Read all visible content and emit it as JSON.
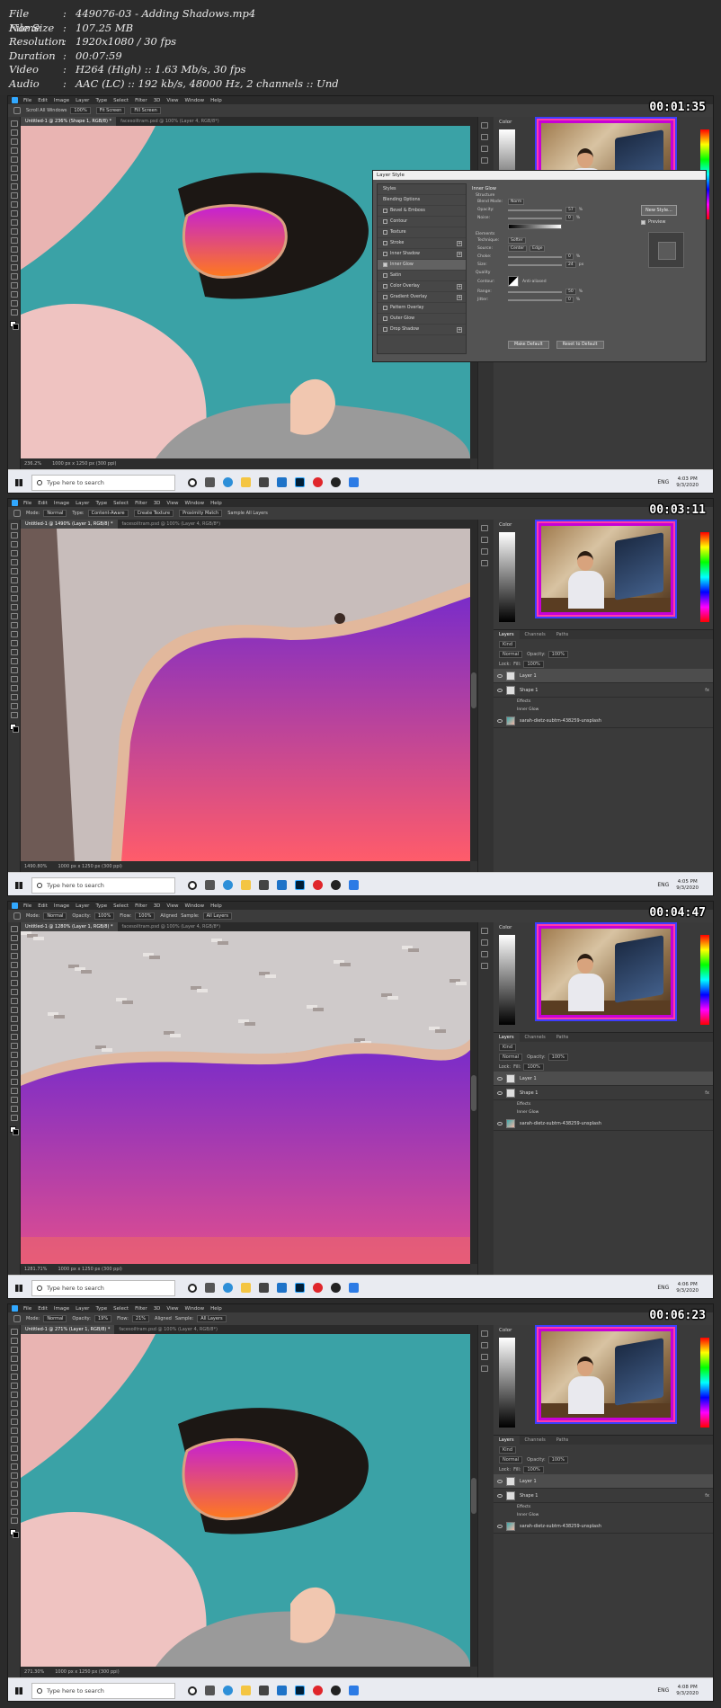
{
  "info": {
    "rows": [
      {
        "key": "File Name",
        "value": "449076-03 - Adding Shadows.mp4"
      },
      {
        "key": "File Size",
        "value": "107.25 MB"
      },
      {
        "key": "Resolution",
        "value": "1920x1080 / 30 fps"
      },
      {
        "key": "Duration",
        "value": "00:07:59"
      },
      {
        "key": "Video",
        "value": "H264 (High) :: 1.63 Mb/s, 30 fps"
      },
      {
        "key": "Audio",
        "value": "AAC (LC) :: 192 kb/s, 48000 Hz, 2 channels :: Und"
      }
    ]
  },
  "menu": [
    "File",
    "Edit",
    "Image",
    "Layer",
    "Type",
    "Select",
    "Filter",
    "3D",
    "View",
    "Window",
    "Help"
  ],
  "taskbar": {
    "search_placeholder": "Type here to search",
    "lang": "ENG"
  },
  "frames": [
    {
      "timestamp": "00:01:35",
      "tab_active": "Untitled-1 @ 236% (Shape 1, RGB/8) *",
      "tab_other": "facesoiltram.psd @ 100% (Layer 4, RGB/8*)",
      "options": {
        "label1": "Scroll All Windows",
        "box1": "100%",
        "box2": "Fit Screen",
        "box3": "Fill Screen"
      },
      "status_zoom": "236.2%",
      "status_doc": "1000 px x 1250 px (300 ppi)",
      "clock_time": "4:03 PM",
      "clock_date": "9/3/2020"
    },
    {
      "timestamp": "00:03:11",
      "tab_active": "Untitled-1 @ 1490% (Layer 1, RGB/8) *",
      "tab_other": "facesoiltram.psd @ 100% (Layer 4, RGB/8*)",
      "options": {
        "label1": "Mode:",
        "box1": "Normal",
        "label2": "Type:",
        "box2": "Content-Aware",
        "box3": "Create Texture",
        "box4": "Proximity Match",
        "label3": "Sample All Layers"
      },
      "status_zoom": "1490.80%",
      "status_doc": "1000 px x 1250 px (300 ppi)",
      "clock_time": "4:05 PM",
      "clock_date": "9/3/2020"
    },
    {
      "timestamp": "00:04:47",
      "tab_active": "Untitled-1 @ 1280% (Layer 1, RGB/8) *",
      "tab_other": "facesoiltram.psd @ 100% (Layer 4, RGB/8*)",
      "options": {
        "label1": "Mode:",
        "box1": "Normal",
        "label2": "Opacity:",
        "box2": "100%",
        "label3": "Flow:",
        "box3": "100%",
        "label4": "Aligned",
        "label5": "Sample:",
        "box4": "All Layers"
      },
      "status_zoom": "1281.71%",
      "status_doc": "1000 px x 1250 px (300 ppi)",
      "clock_time": "4:06 PM",
      "clock_date": "9/3/2020"
    },
    {
      "timestamp": "00:06:23",
      "tab_active": "Untitled-1 @ 271% (Layer 1, RGB/8) *",
      "tab_other": "facesoiltram.psd @ 100% (Layer 4, RGB/8*)",
      "options": {
        "label1": "Mode:",
        "box1": "Normal",
        "label2": "Opacity:",
        "box2": "19%",
        "label3": "Flow:",
        "box3": "21%",
        "label4": "Aligned",
        "label5": "Sample:",
        "box4": "All Layers"
      },
      "status_zoom": "271.30%",
      "status_doc": "1000 px x 1250 px (300 ppi)",
      "clock_time": "4:08 PM",
      "clock_date": "9/3/2020"
    }
  ],
  "panels": {
    "color_title": "Color",
    "layers_tabs": [
      "Layers",
      "Channels",
      "Paths"
    ],
    "kind": "Kind",
    "blend": "Normal",
    "opacity_label": "Opacity:",
    "opacity": "100%",
    "lock_label": "Lock:",
    "fill_label": "Fill:",
    "fill": "100%",
    "layer1": "Layer 1",
    "shape1": "Shape 1",
    "effects": "Effects",
    "inner_glow": "Inner Glow",
    "photo": "sarah-dietz-subtrn-438259-unsplash",
    "fx": "fx"
  },
  "dialog": {
    "title": "Layer Style",
    "items": [
      {
        "label": "Styles",
        "check": false,
        "plus": false
      },
      {
        "label": "Blending Options",
        "check": false,
        "plus": false
      },
      {
        "label": "Bevel & Emboss",
        "check": true,
        "plus": false
      },
      {
        "label": "Contour",
        "check": true,
        "plus": false
      },
      {
        "label": "Texture",
        "check": true,
        "plus": false
      },
      {
        "label": "Stroke",
        "check": true,
        "plus": true
      },
      {
        "label": "Inner Shadow",
        "check": true,
        "plus": true
      },
      {
        "label": "Inner Glow",
        "check": true,
        "plus": false,
        "active": true
      },
      {
        "label": "Satin",
        "check": true,
        "plus": false
      },
      {
        "label": "Color Overlay",
        "check": true,
        "plus": true
      },
      {
        "label": "Gradient Overlay",
        "check": true,
        "plus": true
      },
      {
        "label": "Pattern Overlay",
        "check": true,
        "plus": false
      },
      {
        "label": "Outer Glow",
        "check": true,
        "plus": false
      },
      {
        "label": "Drop Shadow",
        "check": true,
        "plus": true
      }
    ],
    "section": "Inner Glow",
    "structure": "Structure",
    "blend_mode_label": "Blend Mode:",
    "blend_mode": "Norm",
    "opacity_label": "Opacity:",
    "opacity": "57",
    "noise_label": "Noise:",
    "noise": "0",
    "elements": "Elements",
    "technique_label": "Technique:",
    "technique": "Softer",
    "source_label": "Source:",
    "source_center": "Center",
    "source_edge": "Edge",
    "choke_label": "Choke:",
    "choke": "0",
    "size_label": "Size:",
    "size": "24",
    "quality": "Quality",
    "contour_label": "Contour:",
    "anti_aliased": "Anti-aliased",
    "range_label": "Range:",
    "range": "50",
    "jitter_label": "Jitter:",
    "jitter": "0",
    "pct": "%",
    "px": "px",
    "make_default": "Make Default",
    "reset_default": "Reset to Default",
    "new_style": "New Style...",
    "preview": "Preview"
  },
  "colors": {
    "gradient_top": "#c41fd6",
    "gradient_bottom": "#ff7a1c",
    "webcam_border": "#c700d6",
    "teal": "#3aa2a6"
  }
}
